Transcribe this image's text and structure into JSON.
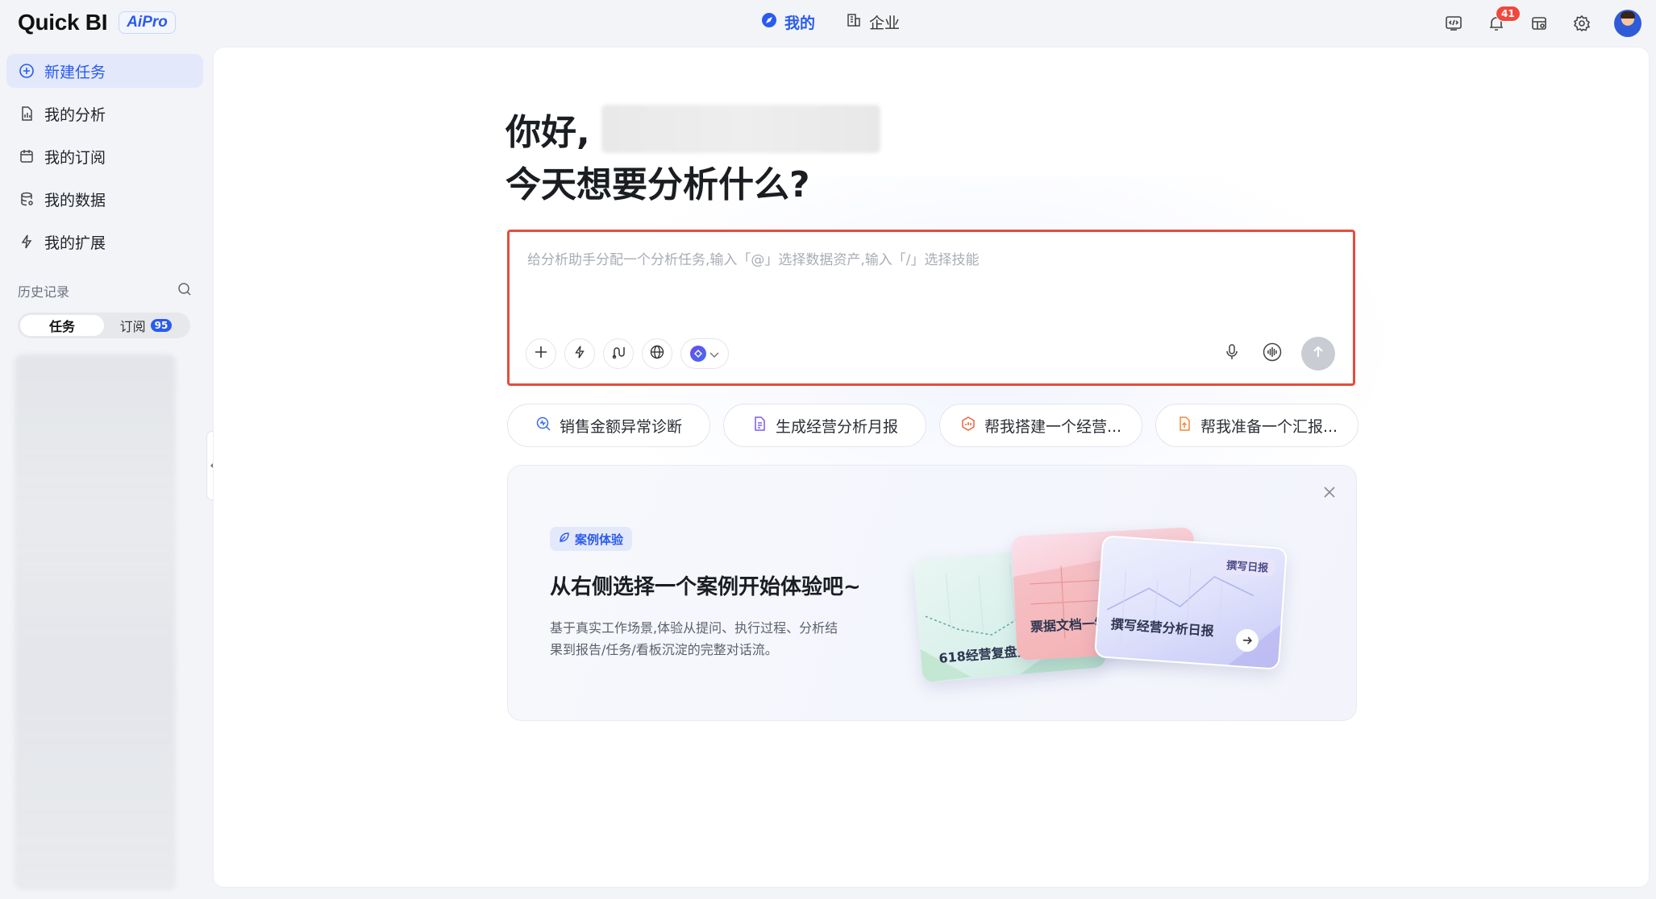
{
  "app": {
    "logo": "Quick BI",
    "badge": "AiPro"
  },
  "top_tabs": [
    {
      "label": "我的"
    },
    {
      "label": "企业"
    }
  ],
  "notifications": {
    "count": "41"
  },
  "sidebar": {
    "items": [
      {
        "label": "新建任务"
      },
      {
        "label": "我的分析"
      },
      {
        "label": "我的订阅"
      },
      {
        "label": "我的数据"
      },
      {
        "label": "我的扩展"
      }
    ],
    "history_title": "历史记录",
    "segments": [
      {
        "label": "任务"
      },
      {
        "label": "订阅",
        "count": "95"
      }
    ]
  },
  "main": {
    "greeting": "你好,",
    "question": "今天想要分析什么?",
    "input": {
      "placeholder": "给分析助手分配一个分析任务,输入「@」选择数据资产,输入「/」选择技能",
      "value": ""
    },
    "suggestions": [
      {
        "label": "销售金额异常诊断"
      },
      {
        "label": "生成经营分析月报"
      },
      {
        "label": "帮我搭建一个经营..."
      },
      {
        "label": "帮我准备一个汇报..."
      }
    ],
    "case": {
      "badge": "案例体验",
      "title": "从右侧选择一个案例开始体验吧~",
      "description": "基于真实工作场景,体验从提问、执行过程、分析结果到报告/任务/看板沉淀的完整对话流。",
      "cards": [
        {
          "label": "618经营复盘分"
        },
        {
          "label": "票据文档一键"
        },
        {
          "label": "撰写经营分析日报",
          "tag": "撰写日报"
        }
      ]
    }
  },
  "colors": {
    "accent": "#2a5bf0",
    "highlight_border": "#e74c3c",
    "badge_red": "#f0483e"
  }
}
